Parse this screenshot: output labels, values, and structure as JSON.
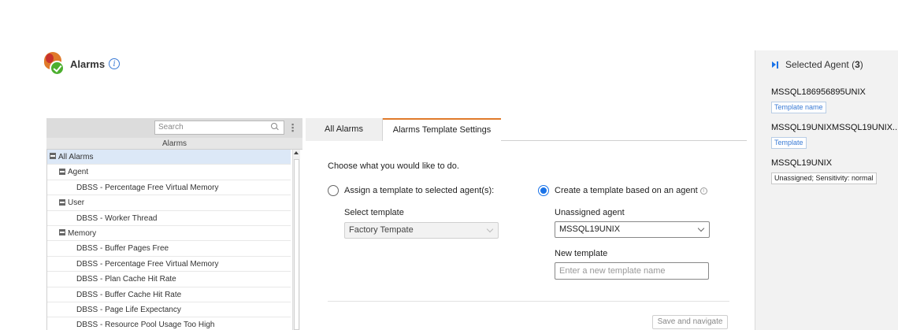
{
  "header": {
    "title": "Alarms",
    "info_glyph": "i"
  },
  "left": {
    "search_placeholder": "Search",
    "column_header": "Alarms",
    "tree": [
      {
        "label": "All Alarms",
        "level": 0,
        "expandable": true,
        "selected": true
      },
      {
        "label": "Agent",
        "level": 1,
        "expandable": true
      },
      {
        "label": "DBSS - Percentage Free Virtual Memory",
        "level": 2
      },
      {
        "label": "User",
        "level": 1,
        "expandable": true
      },
      {
        "label": "DBSS - Worker Thread",
        "level": 2
      },
      {
        "label": "Memory",
        "level": 1,
        "expandable": true
      },
      {
        "label": "DBSS - Buffer Pages Free",
        "level": 2
      },
      {
        "label": "DBSS - Percentage Free Virtual Memory",
        "level": 2
      },
      {
        "label": "DBSS - Plan Cache Hit Rate",
        "level": 2
      },
      {
        "label": "DBSS - Buffer Cache Hit Rate",
        "level": 2
      },
      {
        "label": "DBSS - Page Life Expectancy",
        "level": 2
      },
      {
        "label": "DBSS - Resource Pool Usage Too High",
        "level": 2
      }
    ]
  },
  "tabs": {
    "all_alarms": "All Alarms",
    "template_settings": "Alarms Template Settings"
  },
  "settings": {
    "prompt": "Choose what you would like to do.",
    "option_assign": "Assign a template to selected agent(s):",
    "option_create": "Create a template based on an agent",
    "select_template_label": "Select template",
    "select_template_value": "Factory Tempate",
    "unassigned_agent_label": "Unassigned agent",
    "unassigned_agent_value": "MSSQL19UNIX",
    "new_template_label": "New template",
    "new_template_placeholder": "Enter a new template name",
    "save_button": "Save and navigate",
    "selected_option": "create"
  },
  "right": {
    "title_prefix": "Selected Agent (",
    "count": "3",
    "title_suffix": ")",
    "agents": [
      {
        "name": "MSSQL186956895UNIX",
        "badge": "Template name",
        "badge_style": "link"
      },
      {
        "name": "MSSQL19UNIXMSSQL19UNIX...",
        "badge": "Template",
        "badge_style": "link"
      },
      {
        "name": "MSSQL19UNIX",
        "badge": "Unassigned; Sensitivity: normal",
        "badge_style": "plain"
      }
    ]
  },
  "colors": {
    "accent_orange": "#e07a2a",
    "primary_blue": "#1a73e8",
    "tree_selected_bg": "#dce8f7"
  }
}
